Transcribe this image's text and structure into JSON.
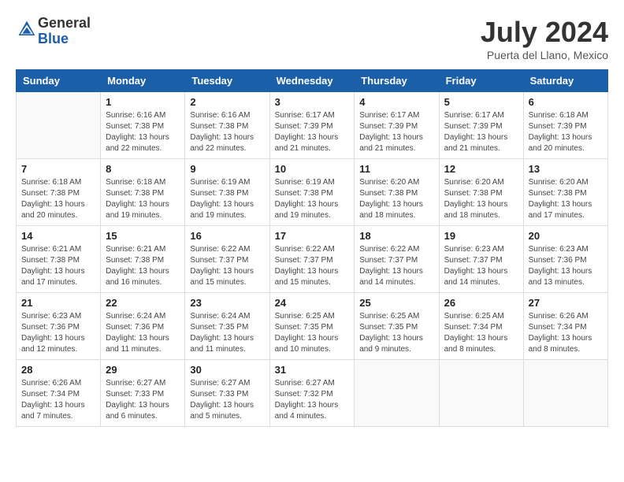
{
  "header": {
    "logo_general": "General",
    "logo_blue": "Blue",
    "month_year": "July 2024",
    "location": "Puerta del Llano, Mexico"
  },
  "calendar": {
    "days_of_week": [
      "Sunday",
      "Monday",
      "Tuesday",
      "Wednesday",
      "Thursday",
      "Friday",
      "Saturday"
    ],
    "weeks": [
      [
        {
          "day": "",
          "info": ""
        },
        {
          "day": "1",
          "info": "Sunrise: 6:16 AM\nSunset: 7:38 PM\nDaylight: 13 hours\nand 22 minutes."
        },
        {
          "day": "2",
          "info": "Sunrise: 6:16 AM\nSunset: 7:38 PM\nDaylight: 13 hours\nand 22 minutes."
        },
        {
          "day": "3",
          "info": "Sunrise: 6:17 AM\nSunset: 7:39 PM\nDaylight: 13 hours\nand 21 minutes."
        },
        {
          "day": "4",
          "info": "Sunrise: 6:17 AM\nSunset: 7:39 PM\nDaylight: 13 hours\nand 21 minutes."
        },
        {
          "day": "5",
          "info": "Sunrise: 6:17 AM\nSunset: 7:39 PM\nDaylight: 13 hours\nand 21 minutes."
        },
        {
          "day": "6",
          "info": "Sunrise: 6:18 AM\nSunset: 7:39 PM\nDaylight: 13 hours\nand 20 minutes."
        }
      ],
      [
        {
          "day": "7",
          "info": "Sunrise: 6:18 AM\nSunset: 7:38 PM\nDaylight: 13 hours\nand 20 minutes."
        },
        {
          "day": "8",
          "info": "Sunrise: 6:18 AM\nSunset: 7:38 PM\nDaylight: 13 hours\nand 19 minutes."
        },
        {
          "day": "9",
          "info": "Sunrise: 6:19 AM\nSunset: 7:38 PM\nDaylight: 13 hours\nand 19 minutes."
        },
        {
          "day": "10",
          "info": "Sunrise: 6:19 AM\nSunset: 7:38 PM\nDaylight: 13 hours\nand 19 minutes."
        },
        {
          "day": "11",
          "info": "Sunrise: 6:20 AM\nSunset: 7:38 PM\nDaylight: 13 hours\nand 18 minutes."
        },
        {
          "day": "12",
          "info": "Sunrise: 6:20 AM\nSunset: 7:38 PM\nDaylight: 13 hours\nand 18 minutes."
        },
        {
          "day": "13",
          "info": "Sunrise: 6:20 AM\nSunset: 7:38 PM\nDaylight: 13 hours\nand 17 minutes."
        }
      ],
      [
        {
          "day": "14",
          "info": "Sunrise: 6:21 AM\nSunset: 7:38 PM\nDaylight: 13 hours\nand 17 minutes."
        },
        {
          "day": "15",
          "info": "Sunrise: 6:21 AM\nSunset: 7:38 PM\nDaylight: 13 hours\nand 16 minutes."
        },
        {
          "day": "16",
          "info": "Sunrise: 6:22 AM\nSunset: 7:37 PM\nDaylight: 13 hours\nand 15 minutes."
        },
        {
          "day": "17",
          "info": "Sunrise: 6:22 AM\nSunset: 7:37 PM\nDaylight: 13 hours\nand 15 minutes."
        },
        {
          "day": "18",
          "info": "Sunrise: 6:22 AM\nSunset: 7:37 PM\nDaylight: 13 hours\nand 14 minutes."
        },
        {
          "day": "19",
          "info": "Sunrise: 6:23 AM\nSunset: 7:37 PM\nDaylight: 13 hours\nand 14 minutes."
        },
        {
          "day": "20",
          "info": "Sunrise: 6:23 AM\nSunset: 7:36 PM\nDaylight: 13 hours\nand 13 minutes."
        }
      ],
      [
        {
          "day": "21",
          "info": "Sunrise: 6:23 AM\nSunset: 7:36 PM\nDaylight: 13 hours\nand 12 minutes."
        },
        {
          "day": "22",
          "info": "Sunrise: 6:24 AM\nSunset: 7:36 PM\nDaylight: 13 hours\nand 11 minutes."
        },
        {
          "day": "23",
          "info": "Sunrise: 6:24 AM\nSunset: 7:35 PM\nDaylight: 13 hours\nand 11 minutes."
        },
        {
          "day": "24",
          "info": "Sunrise: 6:25 AM\nSunset: 7:35 PM\nDaylight: 13 hours\nand 10 minutes."
        },
        {
          "day": "25",
          "info": "Sunrise: 6:25 AM\nSunset: 7:35 PM\nDaylight: 13 hours\nand 9 minutes."
        },
        {
          "day": "26",
          "info": "Sunrise: 6:25 AM\nSunset: 7:34 PM\nDaylight: 13 hours\nand 8 minutes."
        },
        {
          "day": "27",
          "info": "Sunrise: 6:26 AM\nSunset: 7:34 PM\nDaylight: 13 hours\nand 8 minutes."
        }
      ],
      [
        {
          "day": "28",
          "info": "Sunrise: 6:26 AM\nSunset: 7:34 PM\nDaylight: 13 hours\nand 7 minutes."
        },
        {
          "day": "29",
          "info": "Sunrise: 6:27 AM\nSunset: 7:33 PM\nDaylight: 13 hours\nand 6 minutes."
        },
        {
          "day": "30",
          "info": "Sunrise: 6:27 AM\nSunset: 7:33 PM\nDaylight: 13 hours\nand 5 minutes."
        },
        {
          "day": "31",
          "info": "Sunrise: 6:27 AM\nSunset: 7:32 PM\nDaylight: 13 hours\nand 4 minutes."
        },
        {
          "day": "",
          "info": ""
        },
        {
          "day": "",
          "info": ""
        },
        {
          "day": "",
          "info": ""
        }
      ]
    ]
  }
}
